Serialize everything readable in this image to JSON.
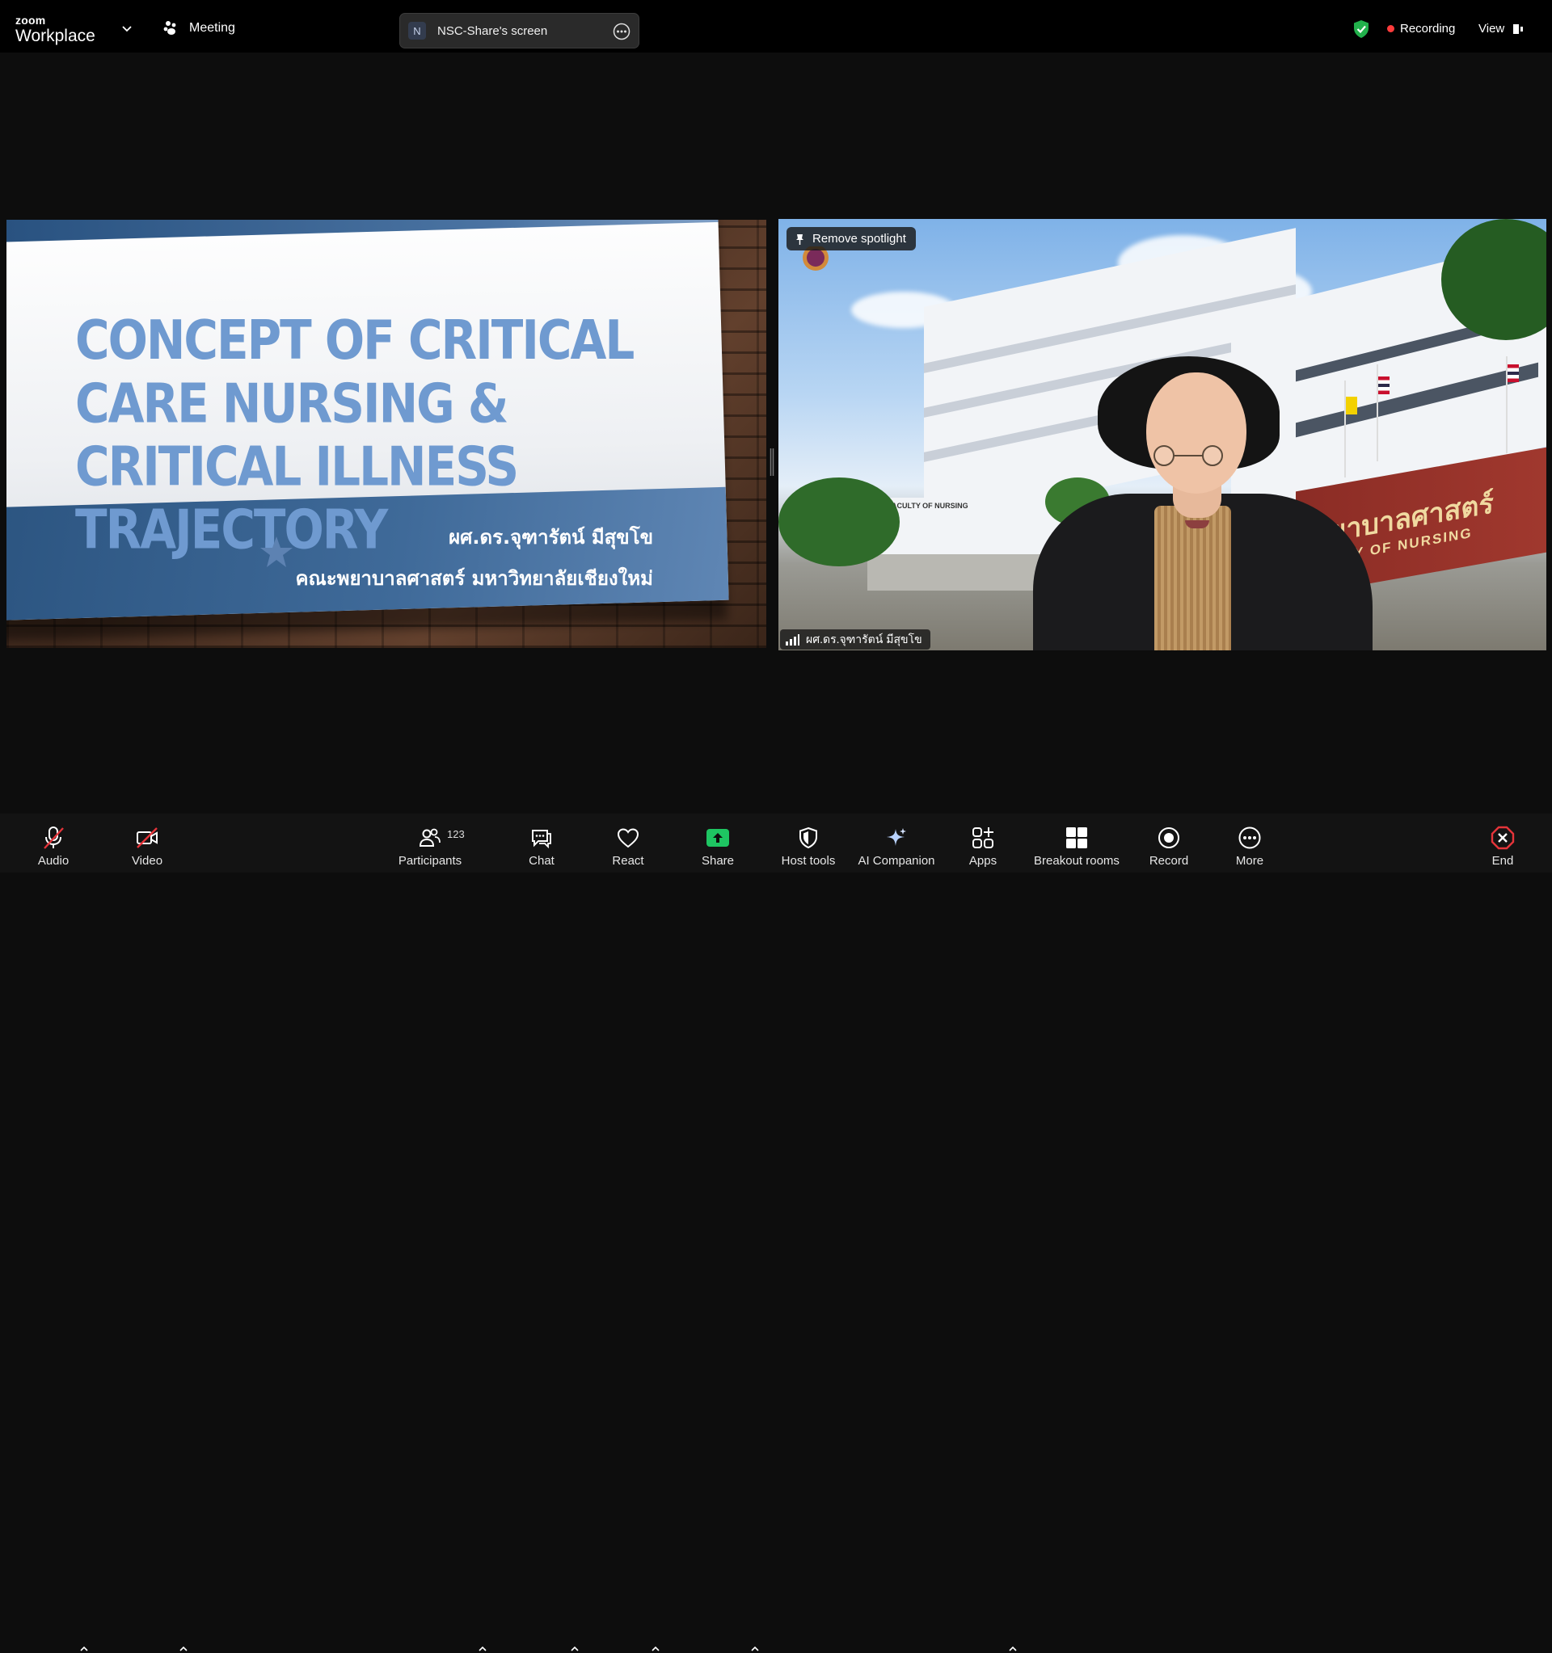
{
  "app": {
    "brand_small": "zoom",
    "brand_large": "Workplace",
    "meeting_label": "Meeting"
  },
  "share_pill": {
    "initial": "N",
    "label": "NSC-Share's screen"
  },
  "status": {
    "recording_label": "Recording",
    "view_label": "View"
  },
  "slide": {
    "title": "CONCEPT OF CRITICAL CARE NURSING & CRITICAL ILLNESS TRAJECTORY",
    "author": "ผศ.ดร.จุฑารัตน์ มีสุขโข",
    "organization": "คณะพยาบาลศาสตร์ มหาวิทยาลัยเชียงใหม่"
  },
  "video": {
    "spotlight_label": "Remove spotlight",
    "participant_name": "ผศ.ดร.จุฑารัตน์ มีสุขโข",
    "sign_thai": "พยาบาลศาสตร์",
    "sign_en": "CULTY OF NURSING",
    "building_sign": "FACULTY OF NURSING"
  },
  "toolbar": {
    "audio": "Audio",
    "video": "Video",
    "participants": "Participants",
    "participants_count": "123",
    "chat": "Chat",
    "react": "React",
    "share": "Share",
    "host_tools": "Host tools",
    "ai_companion": "AI Companion",
    "apps": "Apps",
    "breakout_rooms": "Breakout rooms",
    "record": "Record",
    "more": "More",
    "end": "End"
  },
  "colors": {
    "share_green": "#1ec562",
    "end_red": "#e5343a",
    "security_green": "#22b14c",
    "recording_red": "#ff3b3b"
  },
  "icons": [
    "chevron-down-icon",
    "meeting-icon",
    "more-options-icon",
    "shield-check-icon",
    "view-icon",
    "pin-icon",
    "signal-icon",
    "mic-muted-icon",
    "camera-off-icon",
    "participants-icon",
    "chat-icon",
    "heart-icon",
    "share-arrow-icon",
    "host-shield-icon",
    "sparkle-icon",
    "apps-icon",
    "grid-icon",
    "record-icon",
    "more-icon",
    "end-icon"
  ]
}
